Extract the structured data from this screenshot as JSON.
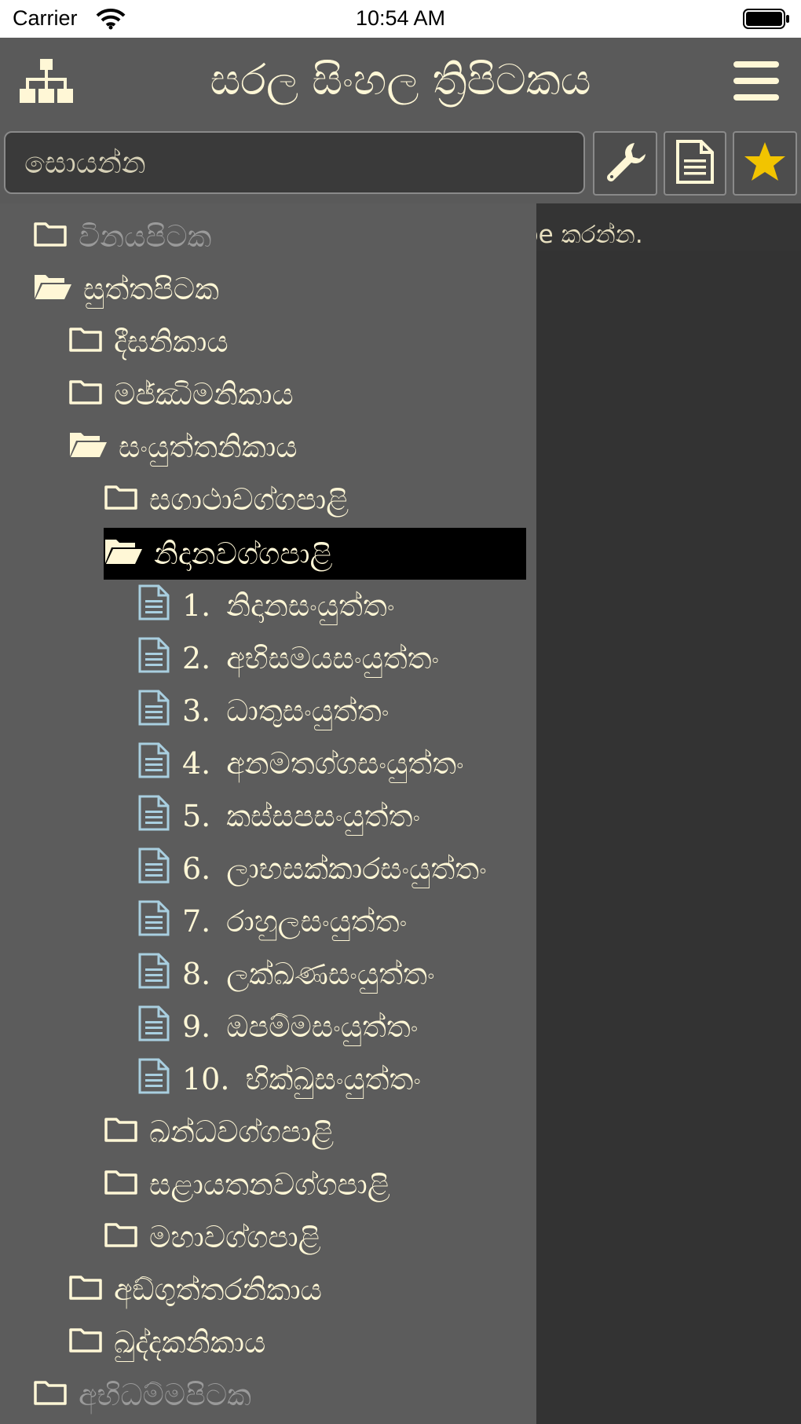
{
  "status_bar": {
    "carrier": "Carrier",
    "time": "10:54 AM"
  },
  "header": {
    "title": "සරල සිංහල ත්‍රිපිටකය",
    "left_icon": "tree-structure-icon",
    "right_icon": "hamburger-menu-icon",
    "accent_color": "#fff7d6"
  },
  "search": {
    "placeholder": "සොයන්න",
    "buttons": [
      "wrench-icon",
      "document-icon",
      "star-icon"
    ],
    "star_color": "#f2c400"
  },
  "main": {
    "hint_text": "pe කරන්න."
  },
  "tree": {
    "vinaya": "විනයපිටක",
    "sutta": "සුත්තපිටක",
    "digha": "දීඝනිකාය",
    "majjhima": "මජ්ඣිමනිකාය",
    "samyutta": "සංයුත්තනිකාය",
    "sagatha": "සගාථාවග්ගපාළි",
    "nidana": "නිදානවග්ගපාළි",
    "suttas": [
      {
        "num": "1.",
        "label": "නිදානසංයුත්තං"
      },
      {
        "num": "2.",
        "label": "අභිසමයසංයුත්තං"
      },
      {
        "num": "3.",
        "label": "ධාතුසංයුත්තං"
      },
      {
        "num": "4.",
        "label": "අනමතග්ගසංයුත්තං"
      },
      {
        "num": "5.",
        "label": "කස්සපසංයුත්තං"
      },
      {
        "num": "6.",
        "label": "ලාභසක්කාරසංයුත්තං"
      },
      {
        "num": "7.",
        "label": "රාහුලසංයුත්තං"
      },
      {
        "num": "8.",
        "label": "ලක්ඛණසංයුත්තං"
      },
      {
        "num": "9.",
        "label": "ඔපම්මසංයුත්තං"
      },
      {
        "num": "10.",
        "label": "භික්ඛුසංයුත්තං"
      }
    ],
    "khandha": "ඛන්ධවග්ගපාළි",
    "salayatana": "සළායතනවග්ගපාළි",
    "maha": "මහාවග්ගපාළි",
    "anguttara": "අඞ්ගුත්තරනිකාය",
    "khuddaka": "ඛුද්දකනිකාය",
    "abhidhamma": "අභිධම්මපිටක"
  }
}
